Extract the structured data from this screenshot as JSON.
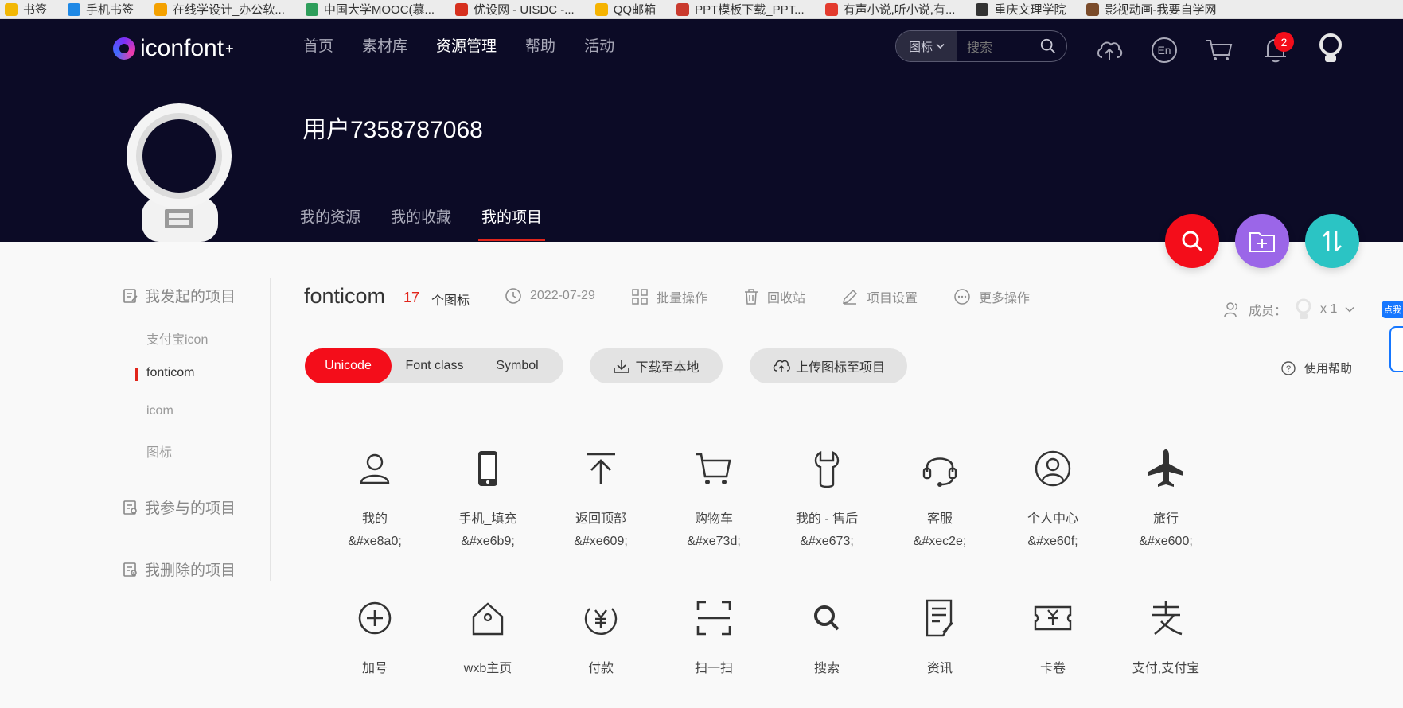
{
  "bookmarks": [
    {
      "label": "书签",
      "color": "#f2b705"
    },
    {
      "label": "手机书签",
      "color": "#1e88e5"
    },
    {
      "label": "在线学设计_办公软...",
      "color": "#f4a100"
    },
    {
      "label": "中国大学MOOC(慕...",
      "color": "#2e9e5b"
    },
    {
      "label": "优设网 - UISDC -...",
      "color": "#d6301e"
    },
    {
      "label": "QQ邮箱",
      "color": "#f5b301"
    },
    {
      "label": "PPT模板下载_PPT...",
      "color": "#c93a2e"
    },
    {
      "label": "有声小说,听小说,有...",
      "color": "#e33b2e"
    },
    {
      "label": "重庆文理学院",
      "color": "#333333"
    },
    {
      "label": "影视动画-我要自学网",
      "color": "#7a4b2a"
    }
  ],
  "header": {
    "logo_text": "iconfont",
    "logo_plus": "+",
    "nav": [
      {
        "label": "首页",
        "active": false
      },
      {
        "label": "素材库",
        "active": false
      },
      {
        "label": "资源管理",
        "active": true
      },
      {
        "label": "帮助",
        "active": false
      },
      {
        "label": "活动",
        "active": false
      }
    ],
    "search_type": "图标",
    "search_placeholder": "搜索",
    "notification_count": "2",
    "icons": [
      "upload-cloud-icon",
      "language-en-icon",
      "cart-icon",
      "bell-icon",
      "user-avatar-icon"
    ]
  },
  "profile": {
    "username": "用户7358787068",
    "tabs": [
      {
        "label": "我的资源",
        "active": false
      },
      {
        "label": "我的收藏",
        "active": false
      },
      {
        "label": "我的项目",
        "active": true
      }
    ]
  },
  "fabs": [
    {
      "name": "search-fab",
      "color": "#f40d1a"
    },
    {
      "name": "add-folder-fab",
      "color": "#9b66e8"
    },
    {
      "name": "sort-fab",
      "color": "#2bc4c4"
    }
  ],
  "sidebar": {
    "group_initiated": "我发起的项目",
    "projects": [
      {
        "label": "支付宝icon",
        "active": false
      },
      {
        "label": "fonticom",
        "active": true
      },
      {
        "label": "icom",
        "active": false
      },
      {
        "label": "图标",
        "active": false
      }
    ],
    "group_joined": "我参与的项目",
    "group_deleted": "我删除的项目"
  },
  "project": {
    "title": "fonticom",
    "count": "17",
    "count_label": "个图标",
    "date": "2022-07-29",
    "batch": "批量操作",
    "recycle": "回收站",
    "settings": "项目设置",
    "more": "更多操作",
    "members_label": "成员：",
    "members_count": "x 1",
    "formats": [
      "Unicode",
      "Font class",
      "Symbol"
    ],
    "active_format": "Unicode",
    "download": "下载至本地",
    "upload": "上传图标至项目",
    "help": "使用帮助",
    "side_tab": "点我"
  },
  "icons": [
    {
      "icon": "user-icon",
      "name": "我的",
      "code": "&#xe8a0;"
    },
    {
      "icon": "phone-icon",
      "name": "手机_填充",
      "code": "&#xe6b9;"
    },
    {
      "icon": "back-to-top-icon",
      "name": "返回顶部",
      "code": "&#xe609;"
    },
    {
      "icon": "cart-icon",
      "name": "购物车",
      "code": "&#xe73d;"
    },
    {
      "icon": "wrench-icon",
      "name": "我的 - 售后",
      "code": "&#xe673;"
    },
    {
      "icon": "headset-icon",
      "name": "客服",
      "code": "&#xec2e;"
    },
    {
      "icon": "user-circle-icon",
      "name": "个人中心",
      "code": "&#xe60f;"
    },
    {
      "icon": "airplane-icon",
      "name": "旅行",
      "code": "&#xe600;"
    },
    {
      "icon": "plus-circle-icon",
      "name": "加号",
      "code": ""
    },
    {
      "icon": "home-icon",
      "name": "wxb主页",
      "code": ""
    },
    {
      "icon": "yen-pay-icon",
      "name": "付款",
      "code": ""
    },
    {
      "icon": "scan-icon",
      "name": "扫一扫",
      "code": ""
    },
    {
      "icon": "search-icon",
      "name": "搜索",
      "code": ""
    },
    {
      "icon": "news-icon",
      "name": "资讯",
      "code": ""
    },
    {
      "icon": "coupon-icon",
      "name": "卡卷",
      "code": ""
    },
    {
      "icon": "alipay-icon",
      "name": "支付,支付宝",
      "code": ""
    }
  ]
}
